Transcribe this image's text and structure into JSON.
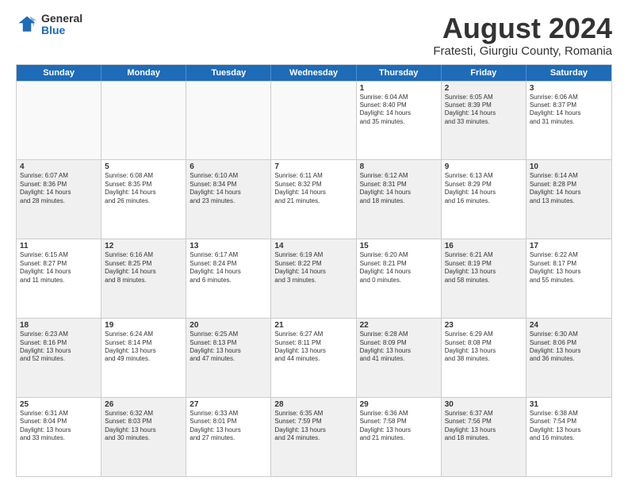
{
  "logo": {
    "general": "General",
    "blue": "Blue"
  },
  "title": "August 2024",
  "subtitle": "Fratesti, Giurgiu County, Romania",
  "weekdays": [
    "Sunday",
    "Monday",
    "Tuesday",
    "Wednesday",
    "Thursday",
    "Friday",
    "Saturday"
  ],
  "rows": [
    [
      {
        "day": "",
        "text": "",
        "empty": true
      },
      {
        "day": "",
        "text": "",
        "empty": true
      },
      {
        "day": "",
        "text": "",
        "empty": true
      },
      {
        "day": "",
        "text": "",
        "empty": true
      },
      {
        "day": "1",
        "text": "Sunrise: 6:04 AM\nSunset: 8:40 PM\nDaylight: 14 hours\nand 35 minutes.",
        "shaded": false
      },
      {
        "day": "2",
        "text": "Sunrise: 6:05 AM\nSunset: 8:39 PM\nDaylight: 14 hours\nand 33 minutes.",
        "shaded": true
      },
      {
        "day": "3",
        "text": "Sunrise: 6:06 AM\nSunset: 8:37 PM\nDaylight: 14 hours\nand 31 minutes.",
        "shaded": false
      }
    ],
    [
      {
        "day": "4",
        "text": "Sunrise: 6:07 AM\nSunset: 8:36 PM\nDaylight: 14 hours\nand 28 minutes.",
        "shaded": true
      },
      {
        "day": "5",
        "text": "Sunrise: 6:08 AM\nSunset: 8:35 PM\nDaylight: 14 hours\nand 26 minutes.",
        "shaded": false
      },
      {
        "day": "6",
        "text": "Sunrise: 6:10 AM\nSunset: 8:34 PM\nDaylight: 14 hours\nand 23 minutes.",
        "shaded": true
      },
      {
        "day": "7",
        "text": "Sunrise: 6:11 AM\nSunset: 8:32 PM\nDaylight: 14 hours\nand 21 minutes.",
        "shaded": false
      },
      {
        "day": "8",
        "text": "Sunrise: 6:12 AM\nSunset: 8:31 PM\nDaylight: 14 hours\nand 18 minutes.",
        "shaded": true
      },
      {
        "day": "9",
        "text": "Sunrise: 6:13 AM\nSunset: 8:29 PM\nDaylight: 14 hours\nand 16 minutes.",
        "shaded": false
      },
      {
        "day": "10",
        "text": "Sunrise: 6:14 AM\nSunset: 8:28 PM\nDaylight: 14 hours\nand 13 minutes.",
        "shaded": true
      }
    ],
    [
      {
        "day": "11",
        "text": "Sunrise: 6:15 AM\nSunset: 8:27 PM\nDaylight: 14 hours\nand 11 minutes.",
        "shaded": false
      },
      {
        "day": "12",
        "text": "Sunrise: 6:16 AM\nSunset: 8:25 PM\nDaylight: 14 hours\nand 8 minutes.",
        "shaded": true
      },
      {
        "day": "13",
        "text": "Sunrise: 6:17 AM\nSunset: 8:24 PM\nDaylight: 14 hours\nand 6 minutes.",
        "shaded": false
      },
      {
        "day": "14",
        "text": "Sunrise: 6:19 AM\nSunset: 8:22 PM\nDaylight: 14 hours\nand 3 minutes.",
        "shaded": true
      },
      {
        "day": "15",
        "text": "Sunrise: 6:20 AM\nSunset: 8:21 PM\nDaylight: 14 hours\nand 0 minutes.",
        "shaded": false
      },
      {
        "day": "16",
        "text": "Sunrise: 6:21 AM\nSunset: 8:19 PM\nDaylight: 13 hours\nand 58 minutes.",
        "shaded": true
      },
      {
        "day": "17",
        "text": "Sunrise: 6:22 AM\nSunset: 8:17 PM\nDaylight: 13 hours\nand 55 minutes.",
        "shaded": false
      }
    ],
    [
      {
        "day": "18",
        "text": "Sunrise: 6:23 AM\nSunset: 8:16 PM\nDaylight: 13 hours\nand 52 minutes.",
        "shaded": true
      },
      {
        "day": "19",
        "text": "Sunrise: 6:24 AM\nSunset: 8:14 PM\nDaylight: 13 hours\nand 49 minutes.",
        "shaded": false
      },
      {
        "day": "20",
        "text": "Sunrise: 6:25 AM\nSunset: 8:13 PM\nDaylight: 13 hours\nand 47 minutes.",
        "shaded": true
      },
      {
        "day": "21",
        "text": "Sunrise: 6:27 AM\nSunset: 8:11 PM\nDaylight: 13 hours\nand 44 minutes.",
        "shaded": false
      },
      {
        "day": "22",
        "text": "Sunrise: 6:28 AM\nSunset: 8:09 PM\nDaylight: 13 hours\nand 41 minutes.",
        "shaded": true
      },
      {
        "day": "23",
        "text": "Sunrise: 6:29 AM\nSunset: 8:08 PM\nDaylight: 13 hours\nand 38 minutes.",
        "shaded": false
      },
      {
        "day": "24",
        "text": "Sunrise: 6:30 AM\nSunset: 8:06 PM\nDaylight: 13 hours\nand 36 minutes.",
        "shaded": true
      }
    ],
    [
      {
        "day": "25",
        "text": "Sunrise: 6:31 AM\nSunset: 8:04 PM\nDaylight: 13 hours\nand 33 minutes.",
        "shaded": false
      },
      {
        "day": "26",
        "text": "Sunrise: 6:32 AM\nSunset: 8:03 PM\nDaylight: 13 hours\nand 30 minutes.",
        "shaded": true
      },
      {
        "day": "27",
        "text": "Sunrise: 6:33 AM\nSunset: 8:01 PM\nDaylight: 13 hours\nand 27 minutes.",
        "shaded": false
      },
      {
        "day": "28",
        "text": "Sunrise: 6:35 AM\nSunset: 7:59 PM\nDaylight: 13 hours\nand 24 minutes.",
        "shaded": true
      },
      {
        "day": "29",
        "text": "Sunrise: 6:36 AM\nSunset: 7:58 PM\nDaylight: 13 hours\nand 21 minutes.",
        "shaded": false
      },
      {
        "day": "30",
        "text": "Sunrise: 6:37 AM\nSunset: 7:56 PM\nDaylight: 13 hours\nand 18 minutes.",
        "shaded": true
      },
      {
        "day": "31",
        "text": "Sunrise: 6:38 AM\nSunset: 7:54 PM\nDaylight: 13 hours\nand 16 minutes.",
        "shaded": false
      }
    ]
  ]
}
